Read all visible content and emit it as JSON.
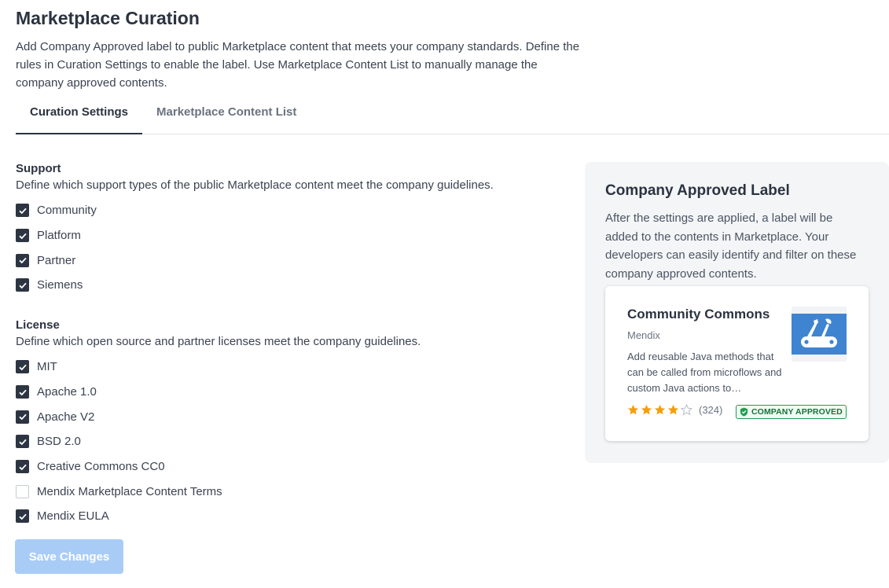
{
  "page": {
    "title": "Marketplace Curation",
    "intro": "Add Company Approved label to public Marketplace content that meets your company standards. Define the rules in Curation Settings to enable the label. Use Marketplace Content List to manually manage the company approved contents."
  },
  "tabs": [
    {
      "label": "Curation Settings",
      "active": true
    },
    {
      "label": "Marketplace Content List",
      "active": false
    }
  ],
  "support": {
    "title": "Support",
    "description": "Define which support types of the public Marketplace content meet the company guidelines.",
    "options": [
      {
        "label": "Community",
        "checked": true
      },
      {
        "label": "Platform",
        "checked": true
      },
      {
        "label": "Partner",
        "checked": true
      },
      {
        "label": "Siemens",
        "checked": true
      }
    ]
  },
  "license": {
    "title": "License",
    "description": "Define which open source and partner licenses meet the company guidelines.",
    "options": [
      {
        "label": "MIT",
        "checked": true
      },
      {
        "label": "Apache 1.0",
        "checked": true
      },
      {
        "label": "Apache V2",
        "checked": true
      },
      {
        "label": "BSD 2.0",
        "checked": true
      },
      {
        "label": "Creative Commons CC0",
        "checked": true
      },
      {
        "label": "Mendix Marketplace Content Terms",
        "checked": false
      },
      {
        "label": "Mendix EULA",
        "checked": true
      }
    ]
  },
  "save_button": {
    "label": "Save Changes",
    "enabled": false
  },
  "panel": {
    "title": "Company Approved Label",
    "description": "After the settings are applied, a label will be added to the contents in Marketplace. Your developers can easily identify and filter on these company approved contents.",
    "card": {
      "title": "Community Commons",
      "vendor": "Mendix",
      "description": "Add reusable Java methods that can be called from microflows and custom Java actions to…",
      "rating": 4,
      "rating_max": 5,
      "review_count": "(324)",
      "badge": "COMPANY APPROVED",
      "logo_icon": "swiss-army-knife-icon"
    }
  },
  "colors": {
    "checkbox_checked": "#2d3542",
    "button_disabled": "#a9ccf7",
    "star": "#f59e0b",
    "badge_green": "#1e9e4f",
    "logo_blue": "#3f84d0"
  }
}
